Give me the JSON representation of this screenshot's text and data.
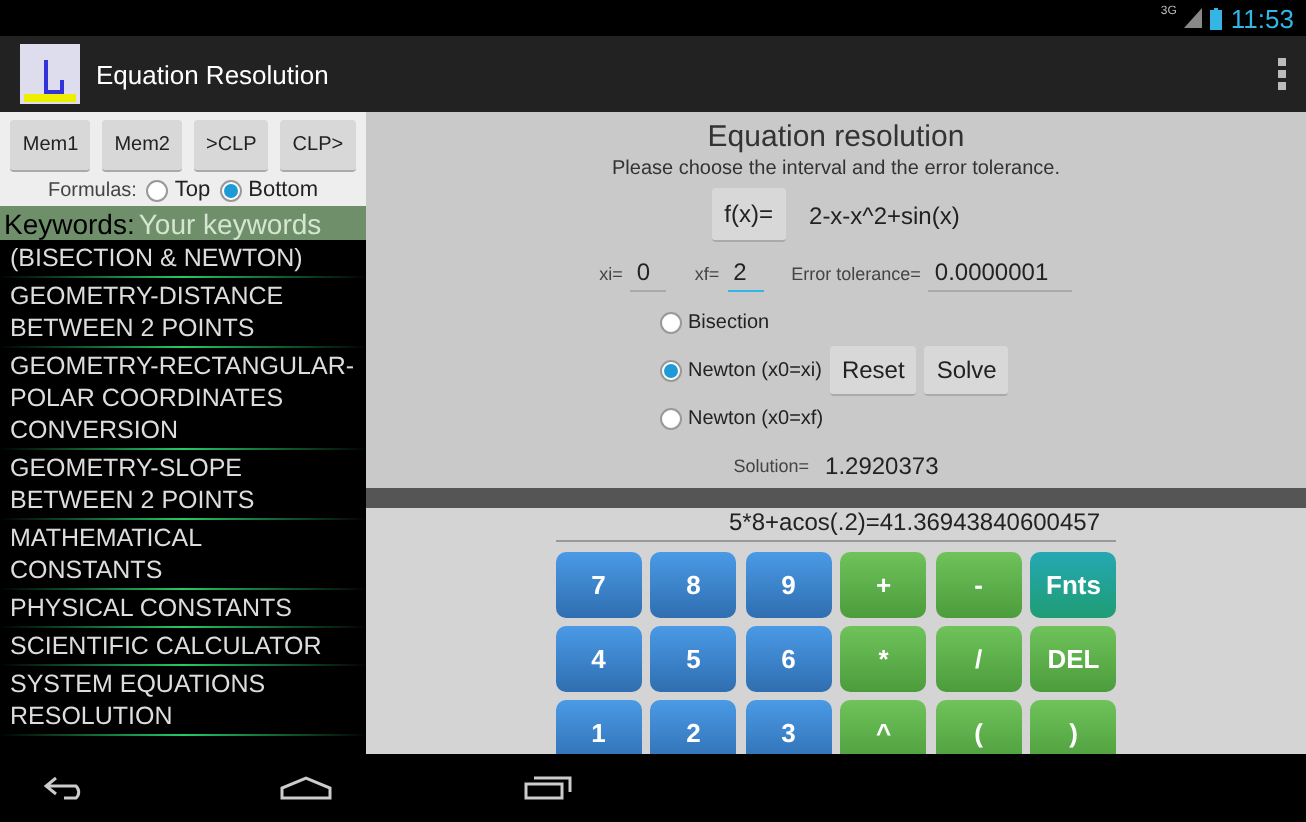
{
  "status_bar": {
    "network": "3G",
    "time": "11:53"
  },
  "action_bar": {
    "title": "Equation Resolution"
  },
  "sidebar": {
    "mem_buttons": [
      "Mem1",
      "Mem2",
      ">CLP",
      "CLP>"
    ],
    "formulas": {
      "label": "Formulas:",
      "options": [
        {
          "label": "Top",
          "selected": false
        },
        {
          "label": "Bottom",
          "selected": true
        }
      ]
    },
    "keywords": {
      "label": "Keywords:",
      "placeholder": "Your keywords"
    },
    "items": [
      {
        "label": "(BISECTION & NEWTON)"
      },
      {
        "label": "GEOMETRY-DISTANCE BETWEEN 2 POINTS"
      },
      {
        "label": "GEOMETRY-RECTANGULAR-POLAR COORDINATES CONVERSION"
      },
      {
        "label": "GEOMETRY-SLOPE BETWEEN 2 POINTS"
      },
      {
        "label": "MATHEMATICAL CONSTANTS"
      },
      {
        "label": "PHYSICAL CONSTANTS"
      },
      {
        "label": "SCIENTIFIC CALCULATOR"
      },
      {
        "label": "SYSTEM EQUATIONS RESOLUTION"
      }
    ]
  },
  "solver": {
    "title": "Equation resolution",
    "subtitle": "Please choose the interval and the error tolerance.",
    "function_button": "f(x)=",
    "function": "2-x-x^2+sin(x)",
    "fields": [
      {
        "label": "xi=",
        "value": "0",
        "focused": false
      },
      {
        "label": "xf=",
        "value": "2",
        "focused": true
      },
      {
        "label": "Error tolerance=",
        "value": "0.0000001",
        "focused": false
      }
    ],
    "methods": [
      {
        "label": "Bisection",
        "selected": false
      },
      {
        "label": "Newton (x0=xi)",
        "selected": true
      },
      {
        "label": "Newton (x0=xf)",
        "selected": false
      }
    ],
    "buttons": [
      "Reset",
      "Solve"
    ],
    "solution_label": "Solution=",
    "solution": "1.2920373"
  },
  "calculator": {
    "display": "5*8+acos(.2)=41.36943840600457",
    "keys": [
      {
        "label": "7",
        "kind": "digit"
      },
      {
        "label": "8",
        "kind": "digit"
      },
      {
        "label": "9",
        "kind": "digit"
      },
      {
        "label": "+",
        "kind": "op"
      },
      {
        "label": "-",
        "kind": "op"
      },
      {
        "label": "Fnts",
        "kind": "fn"
      },
      {
        "label": "4",
        "kind": "digit"
      },
      {
        "label": "5",
        "kind": "digit"
      },
      {
        "label": "6",
        "kind": "digit"
      },
      {
        "label": "*",
        "kind": "op"
      },
      {
        "label": "/",
        "kind": "op"
      },
      {
        "label": "DEL",
        "kind": "op"
      },
      {
        "label": "1",
        "kind": "digit"
      },
      {
        "label": "2",
        "kind": "digit"
      },
      {
        "label": "3",
        "kind": "digit"
      },
      {
        "label": "^",
        "kind": "op"
      },
      {
        "label": "(",
        "kind": "op"
      },
      {
        "label": ")",
        "kind": "op"
      }
    ]
  }
}
